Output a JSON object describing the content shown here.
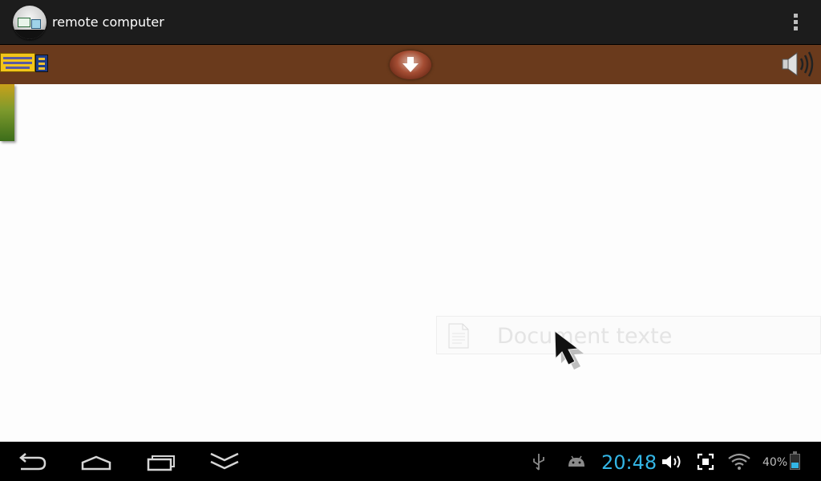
{
  "app_bar": {
    "title": "remote computer",
    "app_icon": "remote-computer-app-icon",
    "menu_icon": "overflow-menu-icon"
  },
  "toolbar": {
    "keyboard_icon": "keyboard-icon",
    "download_icon": "download-arrow-icon",
    "speaker_icon": "speaker-icon",
    "background_color": "#6a3a1c"
  },
  "remote_screen": {
    "document_label": "Document texte",
    "document_icon": "text-document-icon",
    "cursor_icon": "mouse-cursor-icon"
  },
  "status_bar": {
    "time": "20:48",
    "battery_percent": "40%",
    "battery_level": 0.4,
    "accent": "#33b5e5",
    "icons": [
      "usb-icon",
      "android-debug-icon",
      "volume-icon",
      "screenshot-icon",
      "wifi-icon",
      "battery-icon"
    ]
  },
  "nav_bar": {
    "buttons": [
      "back-icon",
      "home-icon",
      "recent-apps-icon",
      "hide-keyboard-icon"
    ]
  }
}
